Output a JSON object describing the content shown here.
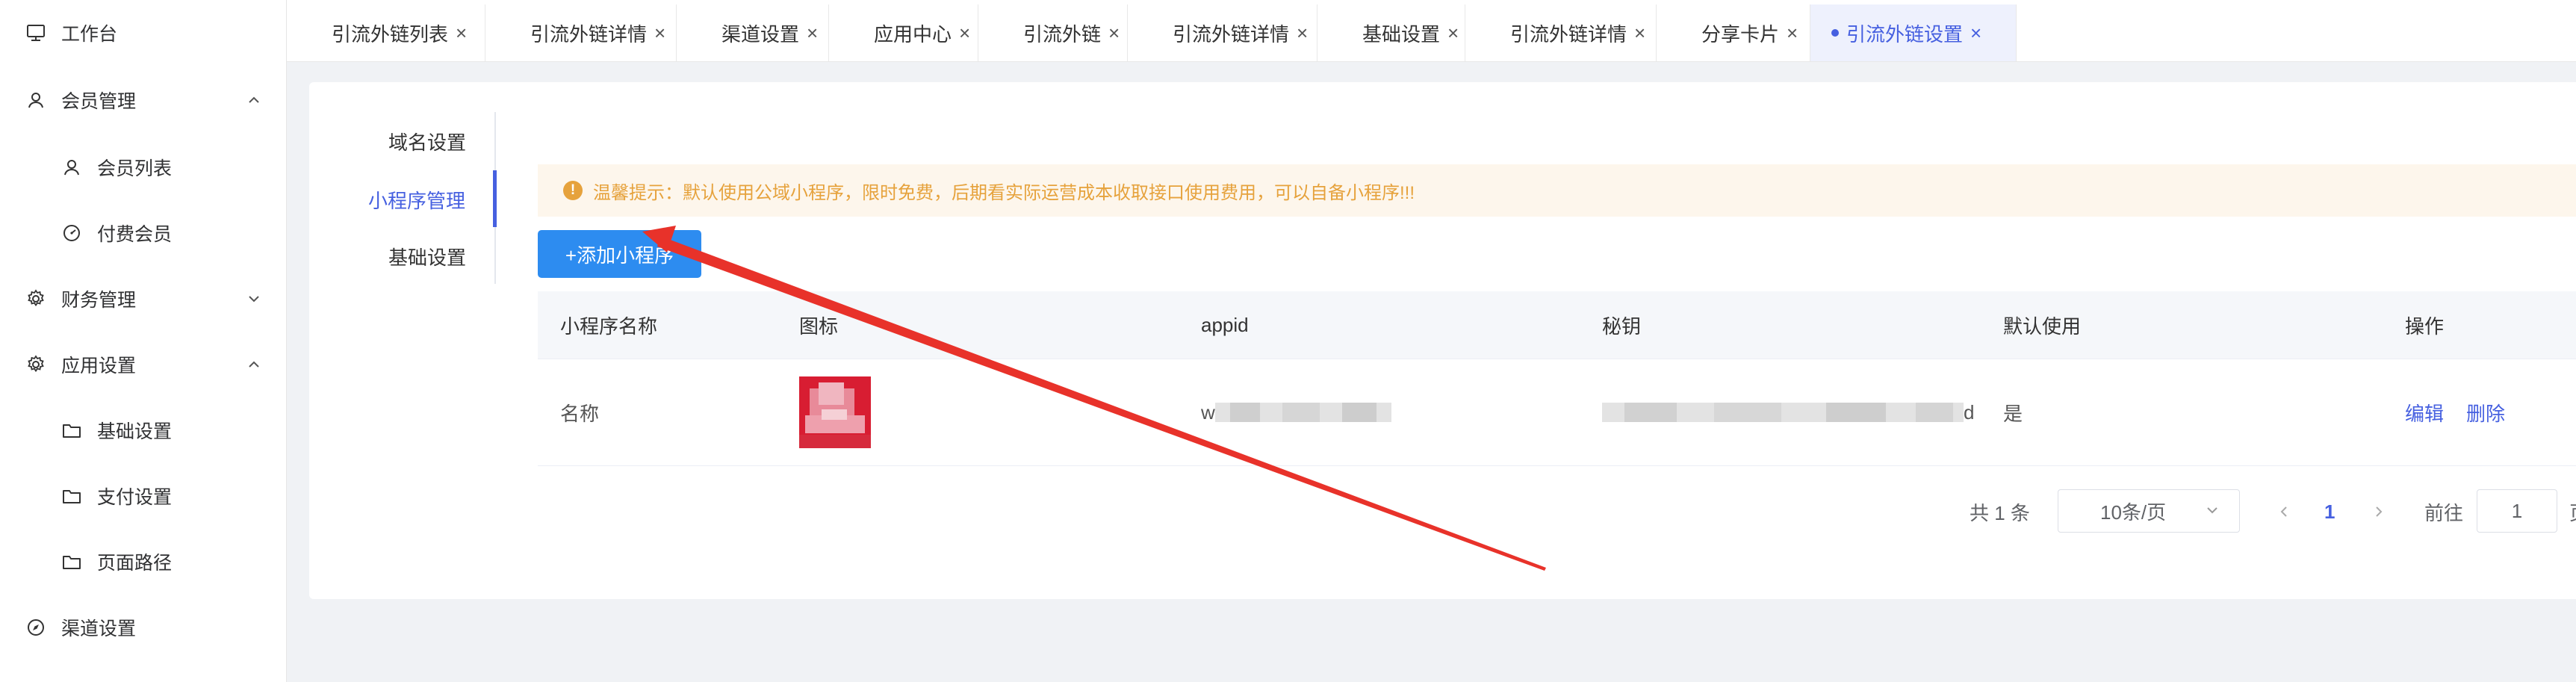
{
  "sidebar": {
    "items": [
      {
        "label": "工作台",
        "icon": "monitor-icon"
      },
      {
        "label": "会员管理",
        "icon": "user-icon",
        "arrow": "chevron-up-icon"
      },
      {
        "label": "会员列表",
        "icon": "user-icon"
      },
      {
        "label": "付费会员",
        "icon": "gauge-icon"
      },
      {
        "label": "财务管理",
        "icon": "gear-icon",
        "arrow": "chevron-down-icon"
      },
      {
        "label": "应用设置",
        "icon": "gear-icon",
        "arrow": "chevron-up-icon"
      },
      {
        "label": "基础设置",
        "icon": "folder-icon"
      },
      {
        "label": "支付设置",
        "icon": "folder-icon"
      },
      {
        "label": "页面路径",
        "icon": "folder-icon"
      },
      {
        "label": "渠道设置",
        "icon": "compass-icon"
      }
    ]
  },
  "tabs": [
    {
      "label": "引流外链列表"
    },
    {
      "label": "引流外链详情"
    },
    {
      "label": "渠道设置"
    },
    {
      "label": "应用中心"
    },
    {
      "label": "引流外链"
    },
    {
      "label": "引流外链详情"
    },
    {
      "label": "基础设置"
    },
    {
      "label": "引流外链详情"
    },
    {
      "label": "分享卡片"
    },
    {
      "label": "引流外链设置",
      "active": true
    }
  ],
  "tab_close": "×",
  "subnav": {
    "items": [
      {
        "label": "域名设置"
      },
      {
        "label": "小程序管理",
        "active": true
      },
      {
        "label": "基础设置"
      }
    ]
  },
  "alert": {
    "text": "温馨提示：默认使用公域小程序，限时免费，后期看实际运营成本收取接口使用费用，可以自备小程序!!!",
    "color": "#e6a23c"
  },
  "add_button": {
    "label": "+添加小程序"
  },
  "table": {
    "columns": [
      "小程序名称",
      "图标",
      "appid",
      "秘钥",
      "默认使用",
      "操作"
    ],
    "rows": [
      {
        "name": "名称",
        "appid_prefix": "w",
        "secret_suffix": "d",
        "default": "是",
        "actions": [
          "编辑",
          "删除"
        ]
      }
    ]
  },
  "pagination": {
    "total": "共 1 条",
    "page_size": "10条/页",
    "current": "1",
    "goto_label": "前往",
    "goto_value": "1",
    "page_suffix": "页"
  },
  "colors": {
    "accent": "#4660e0",
    "primary_button": "#2d8cf0",
    "annotation_arrow": "#e8322a"
  }
}
